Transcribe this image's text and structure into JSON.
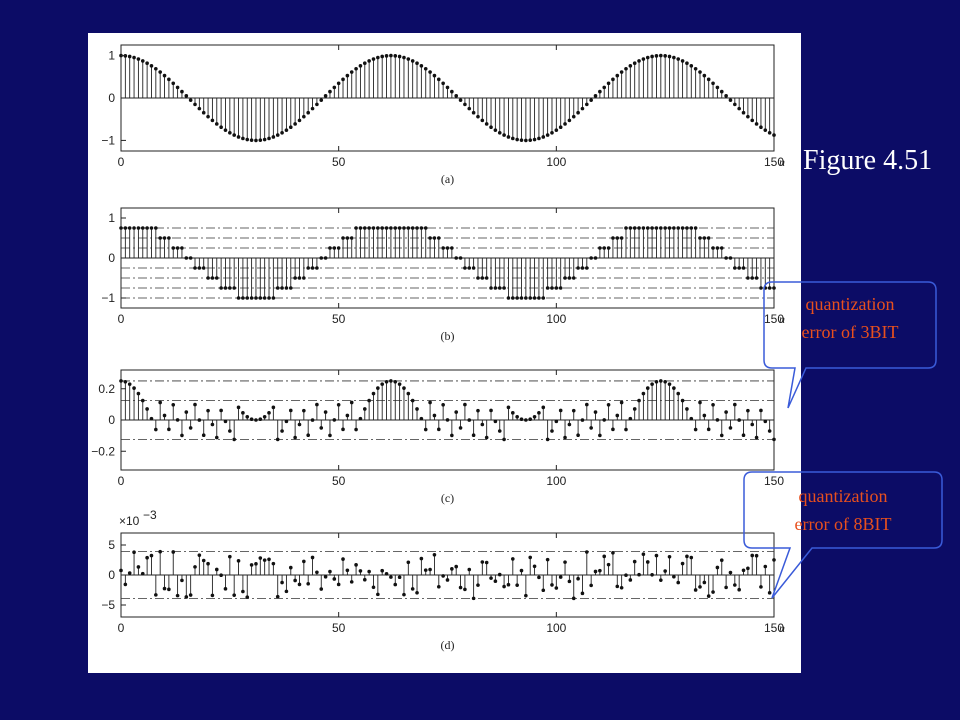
{
  "figure_title": "Figure 4.51",
  "colors": {
    "background": "#0c0c66",
    "callout_text": "#e8501e",
    "callout_border": "#3a5bd9"
  },
  "callouts": [
    {
      "lines": [
        "quantization",
        "error of 3BIT"
      ]
    },
    {
      "lines": [
        "quantization",
        "error of 8BIT"
      ]
    }
  ],
  "chart_data": [
    {
      "type": "stem",
      "panel": "(a)",
      "signal": "cosine",
      "n_range": [
        0,
        150
      ],
      "amplitude": 1,
      "period": 62,
      "xticks": [
        "0",
        "50",
        "100",
        "150"
      ],
      "xlabel_suffix": "n",
      "yticks": [
        "1",
        "0",
        "−1"
      ],
      "ylim": [
        -1.25,
        1.25
      ],
      "gridlines": []
    },
    {
      "type": "stem",
      "panel": "(b)",
      "signal": "3-bit quantized cosine",
      "n_range": [
        0,
        150
      ],
      "levels": [
        -1,
        -0.75,
        -0.5,
        -0.25,
        0,
        0.25,
        0.5,
        0.75
      ],
      "xticks": [
        "0",
        "50",
        "100",
        "150"
      ],
      "xlabel_suffix": "n",
      "yticks": [
        "1",
        "0",
        "−1"
      ],
      "ylim": [
        -1.25,
        1.25
      ],
      "gridlines": [
        0.75,
        0.5,
        0.25,
        -0.25,
        -0.5,
        -0.75,
        -1
      ]
    },
    {
      "type": "stem",
      "panel": "(c)",
      "signal": "quantization error (3-bit)",
      "n_range": [
        0,
        150
      ],
      "xticks": [
        "0",
        "50",
        "100",
        "150"
      ],
      "xlabel_suffix": "",
      "yticks": [
        "0.2",
        "0",
        "−0.2"
      ],
      "ylim": [
        -0.32,
        0.32
      ],
      "gridlines": [
        0.125,
        -0.125,
        0.25
      ]
    },
    {
      "type": "stem",
      "panel": "(d)",
      "signal": "quantization error (8-bit)",
      "n_range": [
        0,
        150
      ],
      "scale_label": "×10",
      "scale_exp": "−3",
      "xticks": [
        "0",
        "50",
        "100",
        "150"
      ],
      "xlabel_suffix": "n",
      "yticks": [
        "5",
        "0",
        "−5"
      ],
      "ylim": [
        -7,
        7
      ],
      "gridlines": [
        3.9,
        -3.9
      ]
    }
  ]
}
